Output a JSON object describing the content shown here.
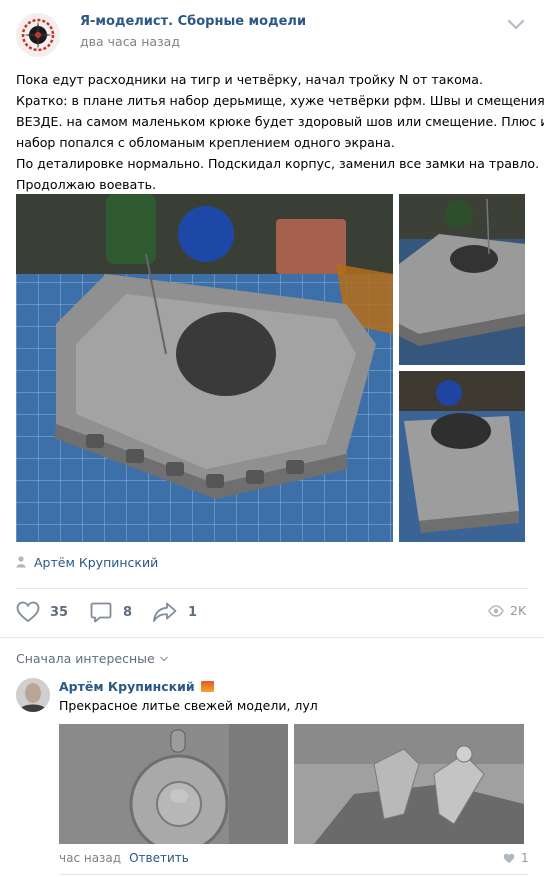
{
  "post": {
    "group_name": "Я-моделист. Сборные модели",
    "time": "два часа назад",
    "text_lines": [
      "Пока едут расходники на тигр и четвёрку, начал тройку N от такома.",
      "Кратко: в плане литья набор дерьмище, хуже четвёрки рфм. Швы и смещения",
      "ВЕЗДЕ. на самом маленьком крюке будет здоровый шов или смещение. Плюс и",
      "набор попался с обломаным креплением одного экрана.",
      "По деталировке нормально. Подскидал корпус, заменил все замки на травло.",
      "Продолжаю воевать."
    ],
    "photos": [
      {
        "icon": "tank-model-photo-main"
      },
      {
        "icon": "tank-model-photo-side"
      },
      {
        "icon": "tank-model-photo-top"
      }
    ],
    "author_signature": "Артём Крупинский",
    "actions": {
      "likes": "35",
      "comments": "8",
      "shares": "1",
      "views": "2K"
    }
  },
  "comments": {
    "sort_label": "Сначала интересные",
    "items": [
      {
        "author": "Артём Крупинский",
        "text": "Прекрасное литье свежей модели, лул",
        "time": "час назад",
        "reply_label": "Ответить",
        "likes": "1"
      }
    ]
  },
  "colors": {
    "link": "#2a5885",
    "secondary": "#828282",
    "icon": "#818c99",
    "divider": "#e7e8ec"
  }
}
